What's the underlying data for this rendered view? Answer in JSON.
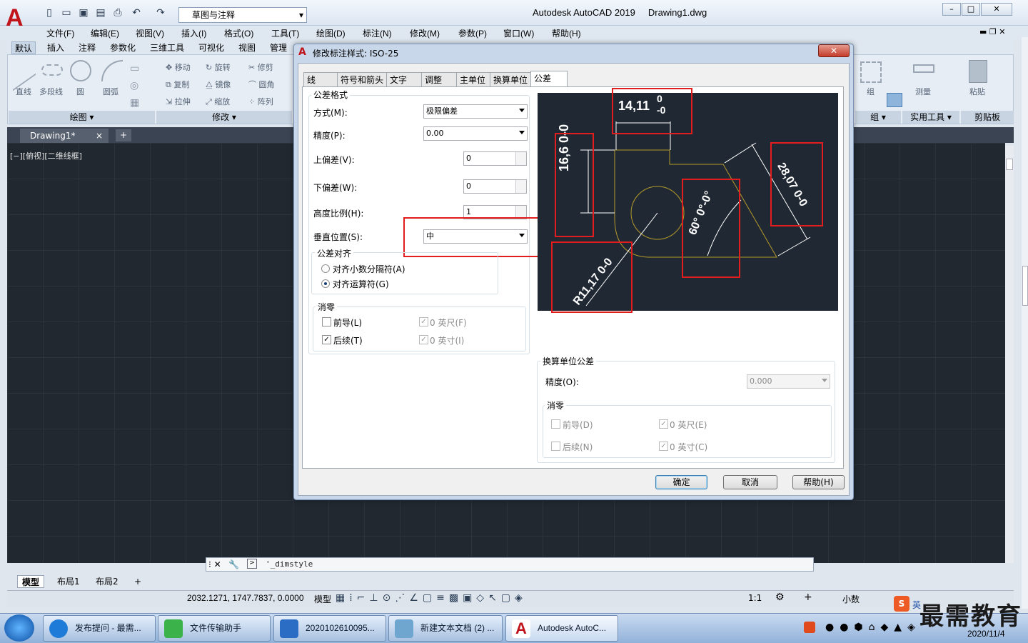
{
  "app": {
    "title": "Autodesk AutoCAD 2019",
    "document": "Drawing1.dwg",
    "workspace": "草图与注释",
    "logo": "A"
  },
  "menus": [
    "文件(F)",
    "编辑(E)",
    "视图(V)",
    "插入(I)",
    "格式(O)",
    "工具(T)",
    "绘图(D)",
    "标注(N)",
    "修改(M)",
    "参数(P)",
    "窗口(W)",
    "帮助(H)"
  ],
  "ribbon": {
    "tabs": [
      "默认",
      "插入",
      "注释",
      "参数化",
      "三维工具",
      "可视化",
      "视图",
      "管理"
    ],
    "draw_tools": [
      "直线",
      "多段线",
      "圆",
      "圆弧"
    ],
    "modify_tools": [
      "移动",
      "旋转",
      "修剪",
      "复制",
      "镜像",
      "圆角",
      "拉伸",
      "缩放",
      "阵列"
    ],
    "right_tools": [
      "组",
      "测量",
      "粘贴"
    ],
    "panels": [
      "绘图",
      "修改",
      "组",
      "实用工具",
      "剪贴板"
    ]
  },
  "doc_tab": "Drawing1*",
  "viewport_label": "[−][俯视][二维线框]",
  "command_text": "'_dimstyle",
  "layout_tabs": [
    "模型",
    "布局1",
    "布局2"
  ],
  "status": {
    "coords": "2032.1271, 1747.7837, 0.0000",
    "model": "模型",
    "scale": "1:1",
    "units": "小数"
  },
  "dialog": {
    "title": "修改标注样式: ISO-25",
    "tabs": [
      "线",
      "符号和箭头",
      "文字",
      "调整",
      "主单位",
      "换算单位",
      "公差"
    ],
    "tolerance_format": {
      "group_label": "公差格式",
      "method_label": "方式(M):",
      "method_value": "极限偏差",
      "precision_label": "精度(P):",
      "precision_value": "0.00",
      "upper_label": "上偏差(V):",
      "upper_value": "0",
      "lower_label": "下偏差(W):",
      "lower_value": "0",
      "height_label": "高度比例(H):",
      "height_value": "1",
      "vpos_label": "垂直位置(S):",
      "vpos_value": "中"
    },
    "alignment": {
      "group_label": "公差对齐",
      "opt1": "对齐小数分隔符(A)",
      "opt2": "对齐运算符(G)"
    },
    "zero_suppression": {
      "group_label": "消零",
      "leading": "前导(L)",
      "trailing": "后续(T)",
      "feet": "0 英尺(F)",
      "inches": "0 英寸(I)"
    },
    "alt_units": {
      "group_label": "换算单位公差",
      "precision_label": "精度(O):",
      "precision_value": "0.000",
      "zero_label": "消零",
      "leading": "前导(D)",
      "trailing": "后续(N)",
      "feet": "0 英尺(E)",
      "inches": "0 英寸(C)"
    },
    "buttons": {
      "ok": "确定",
      "cancel": "取消",
      "help": "帮助(H)"
    }
  },
  "preview": {
    "dim_top": "14,11",
    "dim_top_upper": "0",
    "dim_top_lower": "-0",
    "dim_left": "16,6",
    "dim_left_upper": "0",
    "dim_left_lower": "-0",
    "dim_angle": "60°",
    "dim_angle_upper": "0°",
    "dim_angle_lower": "-0°",
    "dim_right": "28,07",
    "dim_right_upper": "0",
    "dim_right_lower": "-0",
    "dim_radius": "R11,17",
    "dim_radius_upper": "0",
    "dim_radius_lower": "-0"
  },
  "taskbar": {
    "items": [
      "发布提问 - 最需...",
      "文件传输助手",
      "2020102610095...",
      "新建文本文档 (2) ...",
      "Autodesk AutoC..."
    ],
    "date": "2020/11/4",
    "ime": "英"
  },
  "watermark": "最需教育",
  "colors": {
    "canvas": "#212830",
    "accent": "#c0141a",
    "highlight": "#e21d1d",
    "geometry": "#b59a2a"
  }
}
